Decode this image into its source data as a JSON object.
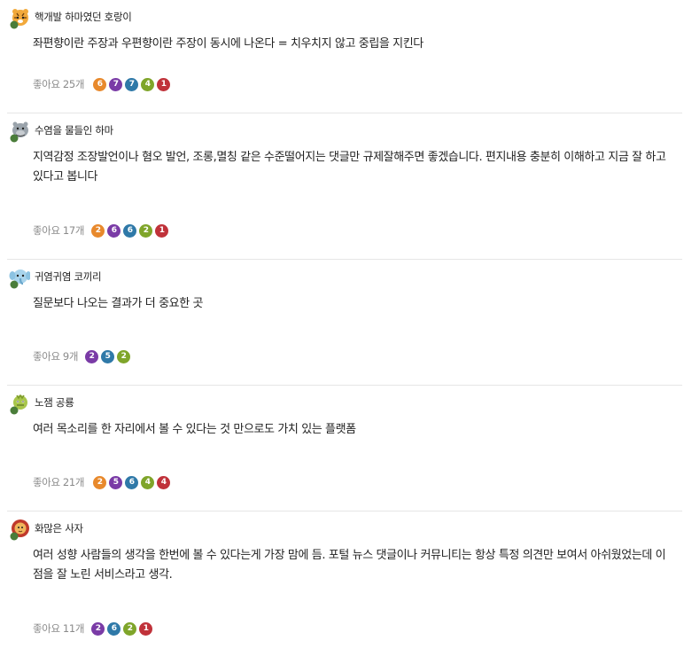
{
  "like_label": "좋아요",
  "comments": [
    {
      "author": "핵개발 하마였던 호랑이",
      "avatar_icon": "tiger-avatar-icon",
      "text": "좌편향이란 주장과 우편향이란 주장이 동시에 나온다 = 치우치지 않고 중립을 지킨다",
      "likes": "25개",
      "reactions": [
        "6",
        "7",
        "7",
        "4",
        "1"
      ]
    },
    {
      "author": "수염을 물들인 하마",
      "avatar_icon": "hippo-avatar-icon",
      "text": "지역감정 조장발언이나 혐오 발언, 조롱,멸칭 같은 수준떨어지는 댓글만 규제잘해주면 좋겠습니다. 편지내용 충분히 이해하고 지금 잘 하고 있다고 봅니다",
      "likes": "17개",
      "reactions": [
        "2",
        "6",
        "6",
        "2",
        "1"
      ]
    },
    {
      "author": "귀염귀염 코끼리",
      "avatar_icon": "elephant-avatar-icon",
      "text": "질문보다 나오는 결과가 더 중요한 곳",
      "likes": "9개",
      "reactions": [
        "2",
        "5",
        "2"
      ]
    },
    {
      "author": "노잼 공룡",
      "avatar_icon": "dinosaur-avatar-icon",
      "text": "여러 목소리를 한 자리에서 볼 수 있다는 것 만으로도 가치 있는 플랫폼",
      "likes": "21개",
      "reactions": [
        "2",
        "5",
        "6",
        "4",
        "4"
      ]
    },
    {
      "author": "화많은 사자",
      "avatar_icon": "lion-avatar-icon",
      "text": "여러 성향 사람들의 생각을 한번에 볼 수 있다는게 가장 맘에 듬. 포털 뉴스 댓글이나 커뮤니티는 항상 특정 의견만 보여서 아쉬웠었는데 이 점을 잘 노린 서비스라고 생각.",
      "likes": "11개",
      "reactions": [
        "2",
        "6",
        "2",
        "1"
      ]
    }
  ],
  "reaction_colors": {
    "orange": "#e8892c",
    "purple": "#7a3ba6",
    "blue": "#2f79a8",
    "green": "#7fa52a",
    "red": "#c0323a"
  }
}
